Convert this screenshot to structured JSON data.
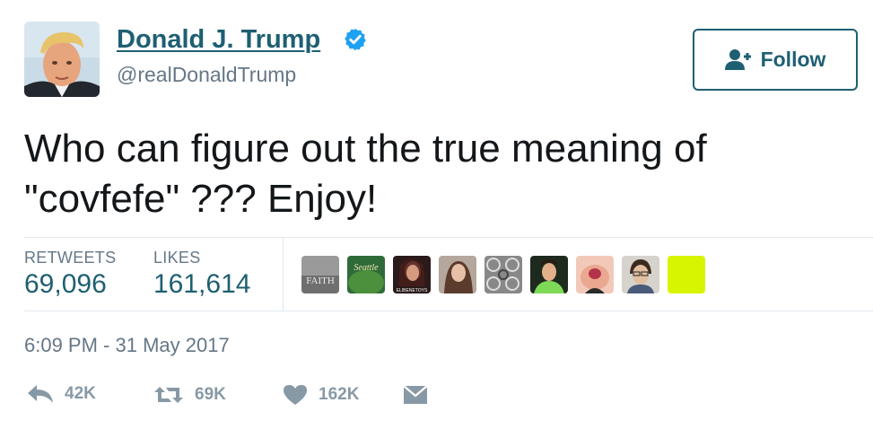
{
  "user": {
    "display_name": "Donald J. Trump",
    "handle": "@realDonaldTrump",
    "verified_icon": "verified-badge-icon",
    "avatar_icon": "profile-photo"
  },
  "follow_button": {
    "label": "Follow",
    "icon": "add-user-icon"
  },
  "tweet": {
    "text": "Who can figure out the true meaning of\n\"covfefe\" ???  Enjoy!"
  },
  "stats": {
    "retweets_label": "RETWEETS",
    "retweets_value": "69,096",
    "likes_label": "LIKES",
    "likes_value": "161,614"
  },
  "likers": [
    {
      "icon": "liker-avatar-faith",
      "text": "FAITH"
    },
    {
      "icon": "liker-avatar-seattle",
      "text": "Seattle"
    },
    {
      "icon": "liker-avatar-3",
      "text": "ELIBENETOYS"
    },
    {
      "icon": "liker-avatar-4",
      "text": ""
    },
    {
      "icon": "liker-avatar-pattern",
      "text": ""
    },
    {
      "icon": "liker-avatar-6",
      "text": ""
    },
    {
      "icon": "liker-avatar-7",
      "text": ""
    },
    {
      "icon": "liker-avatar-8",
      "text": ""
    },
    {
      "icon": "liker-avatar-lime",
      "text": ""
    }
  ],
  "timestamp": "6:09 PM - 31 May 2017",
  "actions": {
    "reply_count": "42K",
    "retweet_count": "69K",
    "like_count": "162K",
    "reply_icon": "reply-icon",
    "retweet_icon": "retweet-icon",
    "like_icon": "heart-icon",
    "dm_icon": "direct-message-icon"
  },
  "colors": {
    "accent": "#1f5f72",
    "muted": "#657786",
    "action_gray": "#8899a6",
    "verified_blue": "#1da1f2",
    "divider": "#e1e8ed"
  }
}
